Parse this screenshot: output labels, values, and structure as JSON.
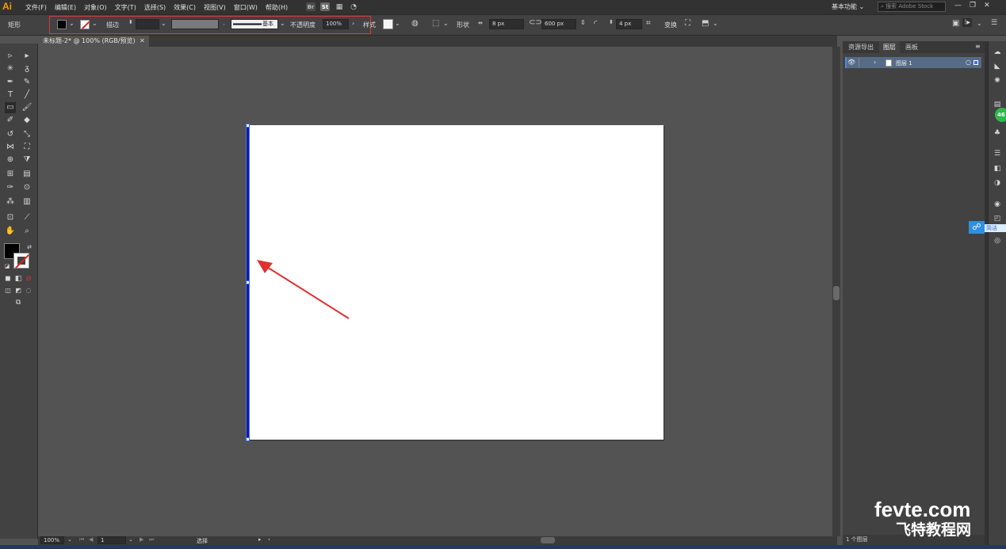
{
  "app": {
    "logo": "Ai"
  },
  "menu": [
    "文件(F)",
    "编辑(E)",
    "对象(O)",
    "文字(T)",
    "选择(S)",
    "效果(C)",
    "视图(V)",
    "窗口(W)",
    "帮助(H)"
  ],
  "menu_icons": {
    "bridge": "Br",
    "stock": "St",
    "workspace_switcher": "▦",
    "gpu": "◔"
  },
  "workspace": "基本功能",
  "search": {
    "placeholder": "搜索 Adobe Stock"
  },
  "window_buttons": [
    "—",
    "❐",
    "✕"
  ],
  "control_bar": {
    "tool_name": "矩形",
    "stroke_label": "描边",
    "brush_label": "基本",
    "opacity_label": "不透明度",
    "opacity_value": "100%",
    "style_label": "样式",
    "shape_label": "形状",
    "width_value": "8 px",
    "height_value": "600 px",
    "corner_value": "4 px",
    "transform_label": "变换",
    "colors": {
      "fill": "#000000",
      "stroke_none": "#ffffff",
      "stroke_weight": "#2d2d2d",
      "variable_width": "#7a7a7a",
      "style_swatch": "#f5f5f5"
    }
  },
  "document_tab": {
    "title": "未标题-2* @ 100% (RGB/预览)",
    "close": "✕"
  },
  "status_bar": {
    "zoom": "100%",
    "artboard": "1",
    "tool": "选择"
  },
  "panel": {
    "tabs": [
      "资源导出",
      "图层",
      "画板"
    ],
    "active_tab": "图层",
    "layer_name": "图层 1",
    "footer": "1 个图层"
  },
  "dock": {
    "badge": "46",
    "float_label": "简洁"
  },
  "watermark": {
    "line1": "fevte.com",
    "line2": "飞特教程网"
  },
  "colors": {
    "accent": "#4e8be0",
    "selection": "#3a6cff",
    "arrow": "#e03030",
    "annotation_box": "#d83a3a"
  }
}
